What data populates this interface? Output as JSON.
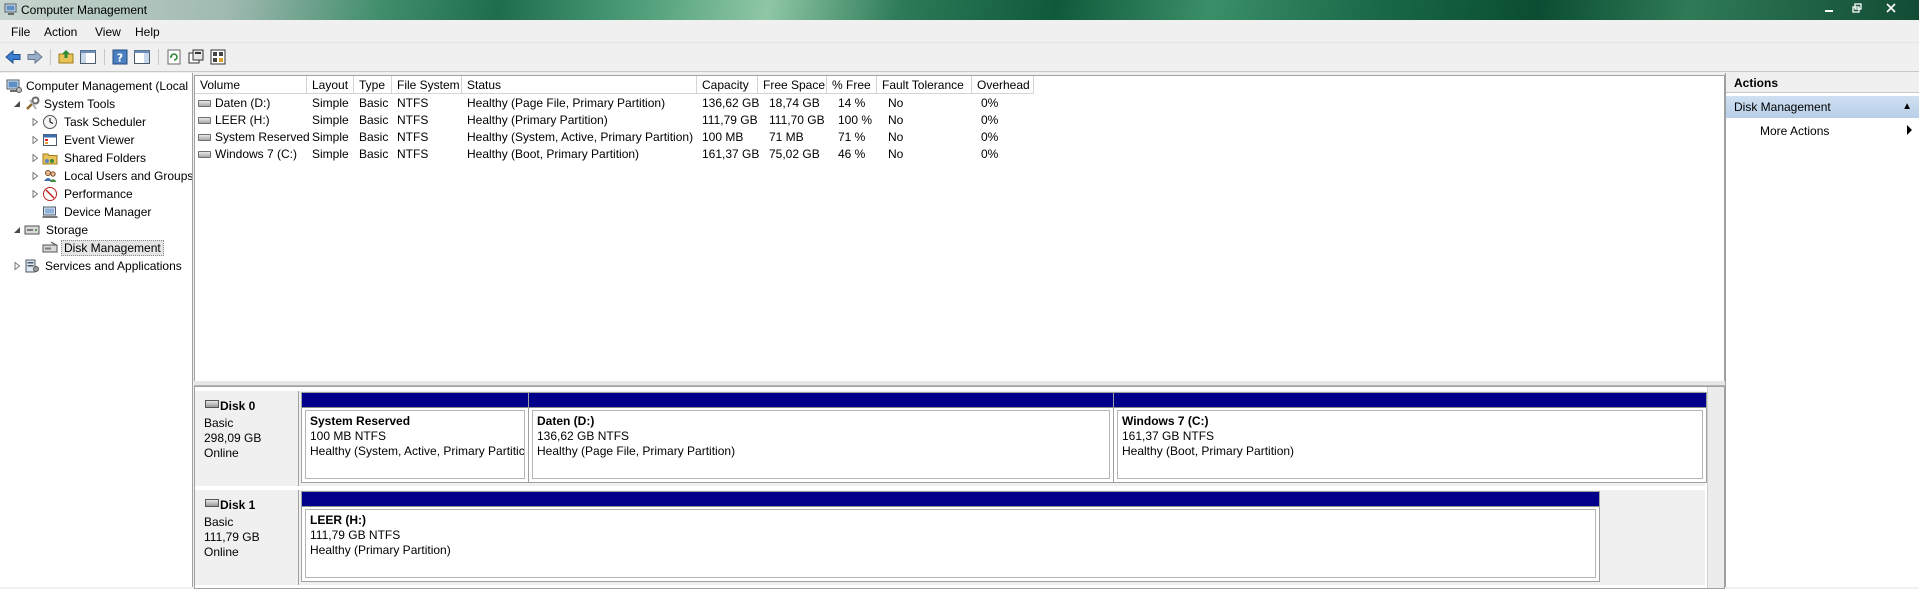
{
  "window": {
    "title": "Computer Management"
  },
  "menu": [
    "File",
    "Action",
    "View",
    "Help"
  ],
  "tree": {
    "items": [
      {
        "label": "Computer Management (Local",
        "level": 0,
        "expander": "none",
        "icon": "computer-management-icon"
      },
      {
        "label": "System Tools",
        "level": 1,
        "expander": "expanded",
        "icon": "tools-icon"
      },
      {
        "label": "Task Scheduler",
        "level": 2,
        "expander": "collapsed",
        "icon": "clock-icon"
      },
      {
        "label": "Event Viewer",
        "level": 2,
        "expander": "collapsed",
        "icon": "event-viewer-icon"
      },
      {
        "label": "Shared Folders",
        "level": 2,
        "expander": "collapsed",
        "icon": "shared-folder-icon"
      },
      {
        "label": "Local Users and Groups",
        "level": 2,
        "expander": "collapsed",
        "icon": "users-icon"
      },
      {
        "label": "Performance",
        "level": 2,
        "expander": "collapsed",
        "icon": "performance-icon"
      },
      {
        "label": "Device Manager",
        "level": 2,
        "expander": "none",
        "icon": "device-manager-icon"
      },
      {
        "label": "Storage",
        "level": 1,
        "expander": "expanded",
        "icon": "storage-icon"
      },
      {
        "label": "Disk Management",
        "level": 2,
        "expander": "none",
        "icon": "disk-management-icon",
        "selected": true
      },
      {
        "label": "Services and Applications",
        "level": 1,
        "expander": "collapsed",
        "icon": "services-icon"
      }
    ]
  },
  "volumes": {
    "columns": [
      "Volume",
      "Layout",
      "Type",
      "File System",
      "Status",
      "Capacity",
      "Free Space",
      "% Free",
      "Fault Tolerance",
      "Overhead"
    ],
    "rows": [
      [
        "Daten (D:)",
        "Simple",
        "Basic",
        "NTFS",
        "Healthy (Page File, Primary Partition)",
        "136,62 GB",
        "18,74 GB",
        "14 %",
        "No",
        "0%"
      ],
      [
        "LEER (H:)",
        "Simple",
        "Basic",
        "NTFS",
        "Healthy (Primary Partition)",
        "111,79 GB",
        "111,70 GB",
        "100 %",
        "No",
        "0%"
      ],
      [
        "System Reserved",
        "Simple",
        "Basic",
        "NTFS",
        "Healthy (System, Active, Primary Partition)",
        "100 MB",
        "71 MB",
        "71 %",
        "No",
        "0%"
      ],
      [
        "Windows 7 (C:)",
        "Simple",
        "Basic",
        "NTFS",
        "Healthy (Boot, Primary Partition)",
        "161,37 GB",
        "75,02 GB",
        "46 %",
        "No",
        "0%"
      ]
    ]
  },
  "disks": [
    {
      "name": "Disk 0",
      "type": "Basic",
      "size": "298,09 GB",
      "status": "Online",
      "partitions": [
        {
          "name": "System Reserved",
          "size": "100 MB NTFS",
          "status": "Healthy (System, Active, Primary Partitic"
        },
        {
          "name": "Daten  (D:)",
          "size": "136,62 GB NTFS",
          "status": "Healthy (Page File, Primary Partition)"
        },
        {
          "name": "Windows 7  (C:)",
          "size": "161,37 GB NTFS",
          "status": "Healthy (Boot, Primary Partition)"
        }
      ]
    },
    {
      "name": "Disk 1",
      "type": "Basic",
      "size": "111,79 GB",
      "status": "Online",
      "partitions": [
        {
          "name": "LEER  (H:)",
          "size": "111,79 GB NTFS",
          "status": "Healthy (Primary Partition)"
        }
      ]
    }
  ],
  "actions": {
    "header": "Actions",
    "section": "Disk Management",
    "items": [
      "More Actions"
    ]
  },
  "colors": {
    "partition_bar": "#00008b",
    "selection_bg": "#e5e5e5",
    "actions_section": "#c4d7ec"
  }
}
